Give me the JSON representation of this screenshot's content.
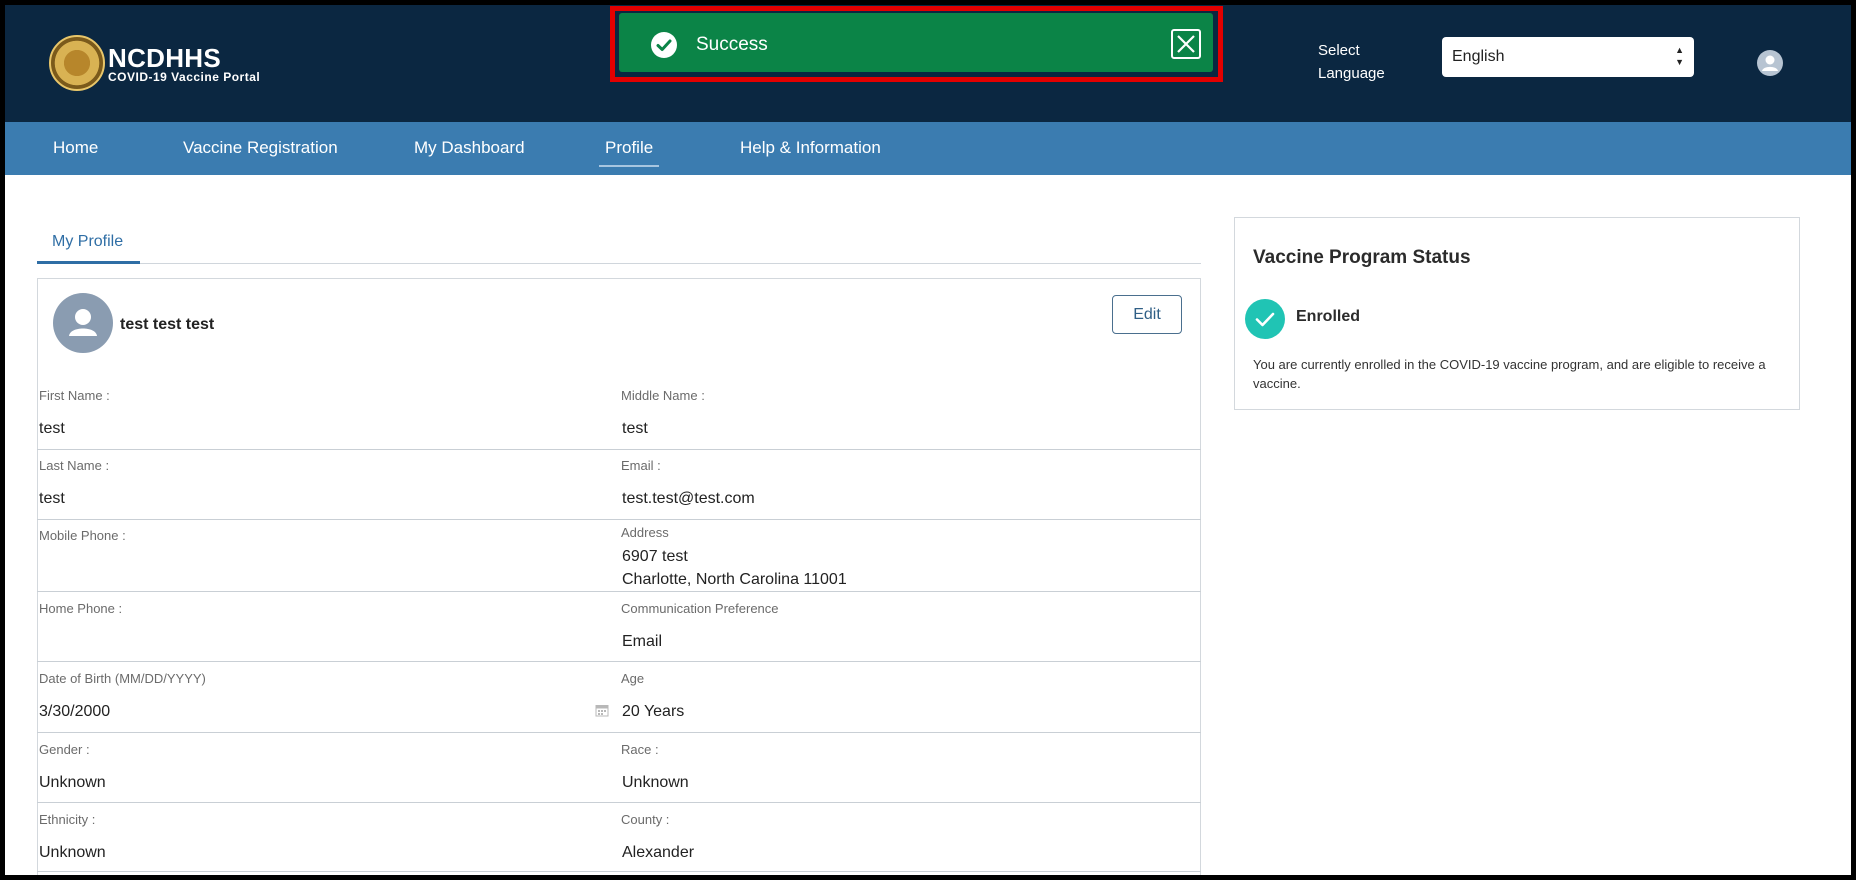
{
  "header": {
    "logo_title": "NCDHHS",
    "logo_subtitle": "COVID-19 Vaccine Portal",
    "language_label": "Select Language",
    "language_value": "English"
  },
  "toast": {
    "message": "Success",
    "status_color": "#0b8447"
  },
  "nav": {
    "items": [
      "Home",
      "Vaccine Registration",
      "My Dashboard",
      "Profile",
      "Help & Information"
    ],
    "active": "Profile"
  },
  "profile": {
    "tab_label": "My Profile",
    "full_name": "test test test",
    "edit_label": "Edit",
    "fields": {
      "first_name": {
        "label": "First Name :",
        "value": "test"
      },
      "middle_name": {
        "label": "Middle Name :",
        "value": "test"
      },
      "last_name": {
        "label": "Last Name :",
        "value": "test"
      },
      "email": {
        "label": "Email :",
        "value": "test.test@test.com"
      },
      "mobile_phone": {
        "label": "Mobile Phone :",
        "value": ""
      },
      "address": {
        "label": "Address",
        "line1": "6907 test",
        "line2": "Charlotte, North Carolina 11001"
      },
      "home_phone": {
        "label": "Home Phone :",
        "value": ""
      },
      "communication": {
        "label": "Communication Preference",
        "value": "Email"
      },
      "dob": {
        "label": "Date of Birth (MM/DD/YYYY)",
        "value": "3/30/2000"
      },
      "age": {
        "label": "Age",
        "value": "20 Years"
      },
      "gender": {
        "label": "Gender :",
        "value": "Unknown"
      },
      "race": {
        "label": "Race :",
        "value": "Unknown"
      },
      "ethnicity": {
        "label": "Ethnicity :",
        "value": "Unknown"
      },
      "county": {
        "label": "County :",
        "value": "Alexander"
      }
    }
  },
  "vaccine_status": {
    "title": "Vaccine Program Status",
    "status": "Enrolled",
    "description": "You are currently enrolled in the COVID-19 vaccine program, and are eligible to receive a vaccine.",
    "status_color": "#20c4b4"
  },
  "icons": [
    "logo-seal",
    "check-circle-icon",
    "close-icon",
    "user-icon",
    "calendar-icon",
    "sort-arrows-icon"
  ]
}
